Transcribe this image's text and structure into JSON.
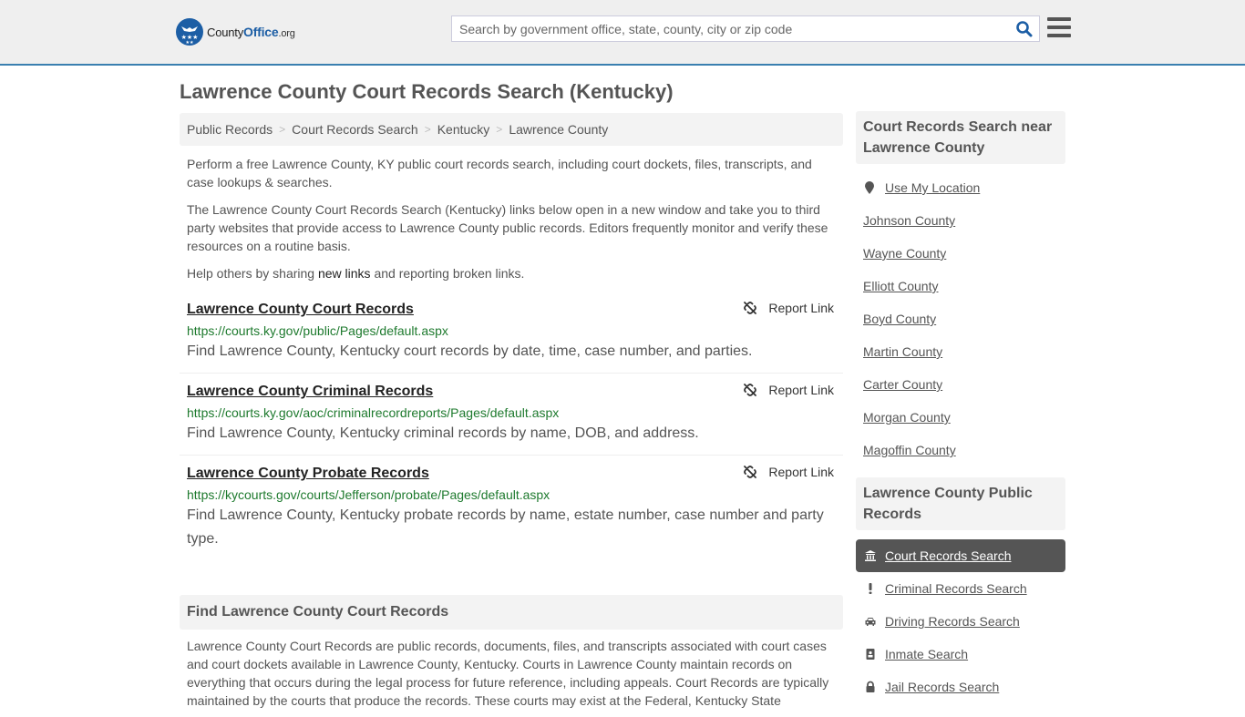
{
  "header": {
    "logo": {
      "county": "County",
      "office": "Office",
      "org": ".org"
    },
    "search_placeholder": "Search by government office, state, county, city or zip code",
    "search_icon": "search-icon",
    "menu_icon": "hamburger-menu-icon"
  },
  "page_title": "Lawrence County Court Records Search (Kentucky)",
  "breadcrumb": [
    "Public Records",
    "Court Records Search",
    "Kentucky",
    "Lawrence County"
  ],
  "intro": {
    "p1": "Perform a free Lawrence County, KY public court records search, including court dockets, files, transcripts, and case lookups & searches.",
    "p2": "The Lawrence County Court Records Search (Kentucky) links below open in a new window and take you to third party websites that provide access to Lawrence County public records. Editors frequently monitor and verify these resources on a routine basis.",
    "p3_before": "Help others by sharing ",
    "p3_link": "new links",
    "p3_after": " and reporting broken links."
  },
  "links": [
    {
      "title": "Lawrence County Court Records",
      "url": "https://courts.ky.gov/public/Pages/default.aspx",
      "desc": "Find Lawrence County, Kentucky court records by date, time, case number, and parties.",
      "report": "Report Link"
    },
    {
      "title": "Lawrence County Criminal Records",
      "url": "https://courts.ky.gov/aoc/criminalrecordreports/Pages/default.aspx",
      "desc": "Find Lawrence County, Kentucky criminal records by name, DOB, and address.",
      "report": "Report Link"
    },
    {
      "title": "Lawrence County Probate Records",
      "url": "https://kycourts.gov/courts/Jefferson/probate/Pages/default.aspx",
      "desc": "Find Lawrence County, Kentucky probate records by name, estate number, case number and party type.",
      "report": "Report Link"
    }
  ],
  "find_section": {
    "heading": "Find Lawrence County Court Records",
    "body": "Lawrence County Court Records are public records, documents, files, and transcripts associated with court cases and court dockets available in Lawrence County, Kentucky. Courts in Lawrence County maintain records on everything that occurs during the legal process for future reference, including appeals. Court Records are typically maintained by the courts that produce the records. These courts may exist at the Federal, Kentucky State"
  },
  "sidebar": {
    "near_heading": "Court Records Search near Lawrence County",
    "use_location": "Use My Location",
    "counties": [
      "Johnson County",
      "Wayne County",
      "Elliott County",
      "Boyd County",
      "Martin County",
      "Carter County",
      "Morgan County",
      "Magoffin County"
    ],
    "public_heading": "Lawrence County Public Records",
    "nav": [
      {
        "label": "Court Records Search",
        "icon": "courthouse-icon",
        "active": true
      },
      {
        "label": "Criminal Records Search",
        "icon": "exclamation-icon",
        "active": false
      },
      {
        "label": "Driving Records Search",
        "icon": "car-icon",
        "active": false
      },
      {
        "label": "Inmate Search",
        "icon": "id-badge-icon",
        "active": false
      },
      {
        "label": "Jail Records Search",
        "icon": "lock-icon",
        "active": false
      }
    ]
  },
  "colors": {
    "brand_blue": "#1c5ea5",
    "header_border": "#3a7fb0",
    "url_green": "#1e7a2e",
    "active_nav": "#555555"
  }
}
